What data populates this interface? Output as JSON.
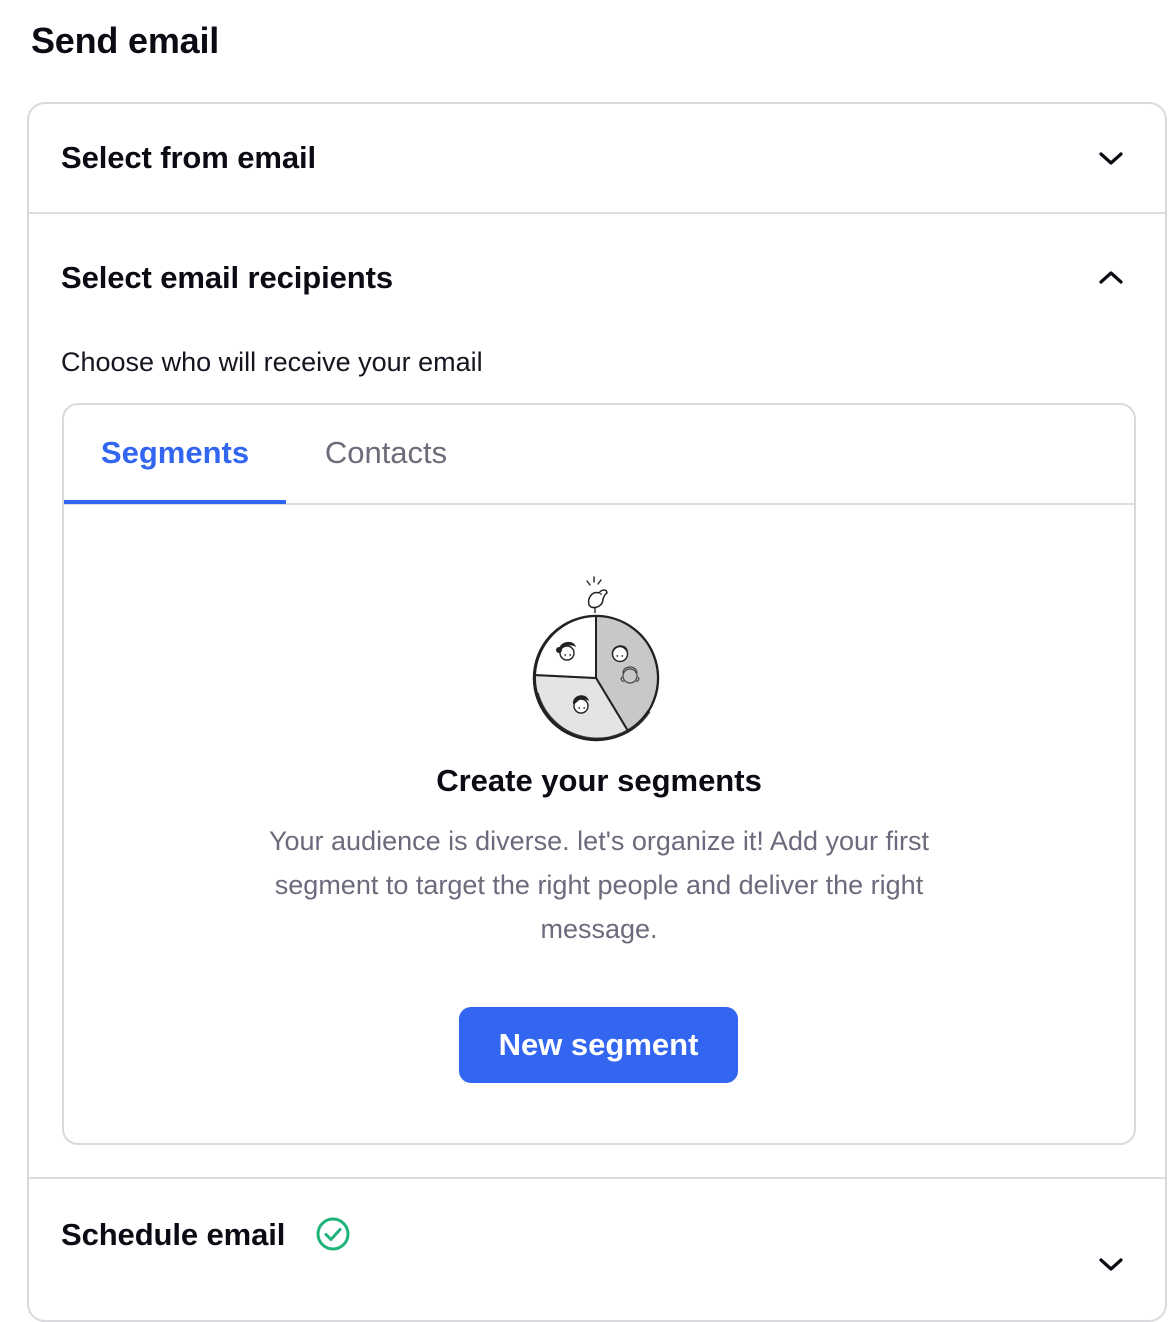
{
  "page": {
    "title": "Send email"
  },
  "sections": {
    "from": {
      "title": "Select from email",
      "icon": "chevron-down-icon",
      "expanded": false
    },
    "recipients": {
      "title": "Select email recipients",
      "icon": "chevron-up-icon",
      "expanded": true,
      "subtitle": "Choose who will receive your email",
      "tabs": [
        {
          "label": "Segments",
          "active": true
        },
        {
          "label": "Contacts",
          "active": false
        }
      ],
      "empty_state": {
        "illustration": "segments-pie-illustration",
        "title": "Create your segments",
        "description": "Your audience is diverse. let's organize it! Add your first segment to target the right people and deliver the right message.",
        "button_label": "New segment"
      }
    },
    "schedule": {
      "title": "Schedule email",
      "status_icon": "check-circle-icon",
      "icon": "chevron-down-icon",
      "expanded": false
    }
  },
  "colors": {
    "accent": "#3366f0",
    "success": "#1fb37a",
    "muted_text": "#6b6b7d",
    "border": "#d9d9de"
  }
}
